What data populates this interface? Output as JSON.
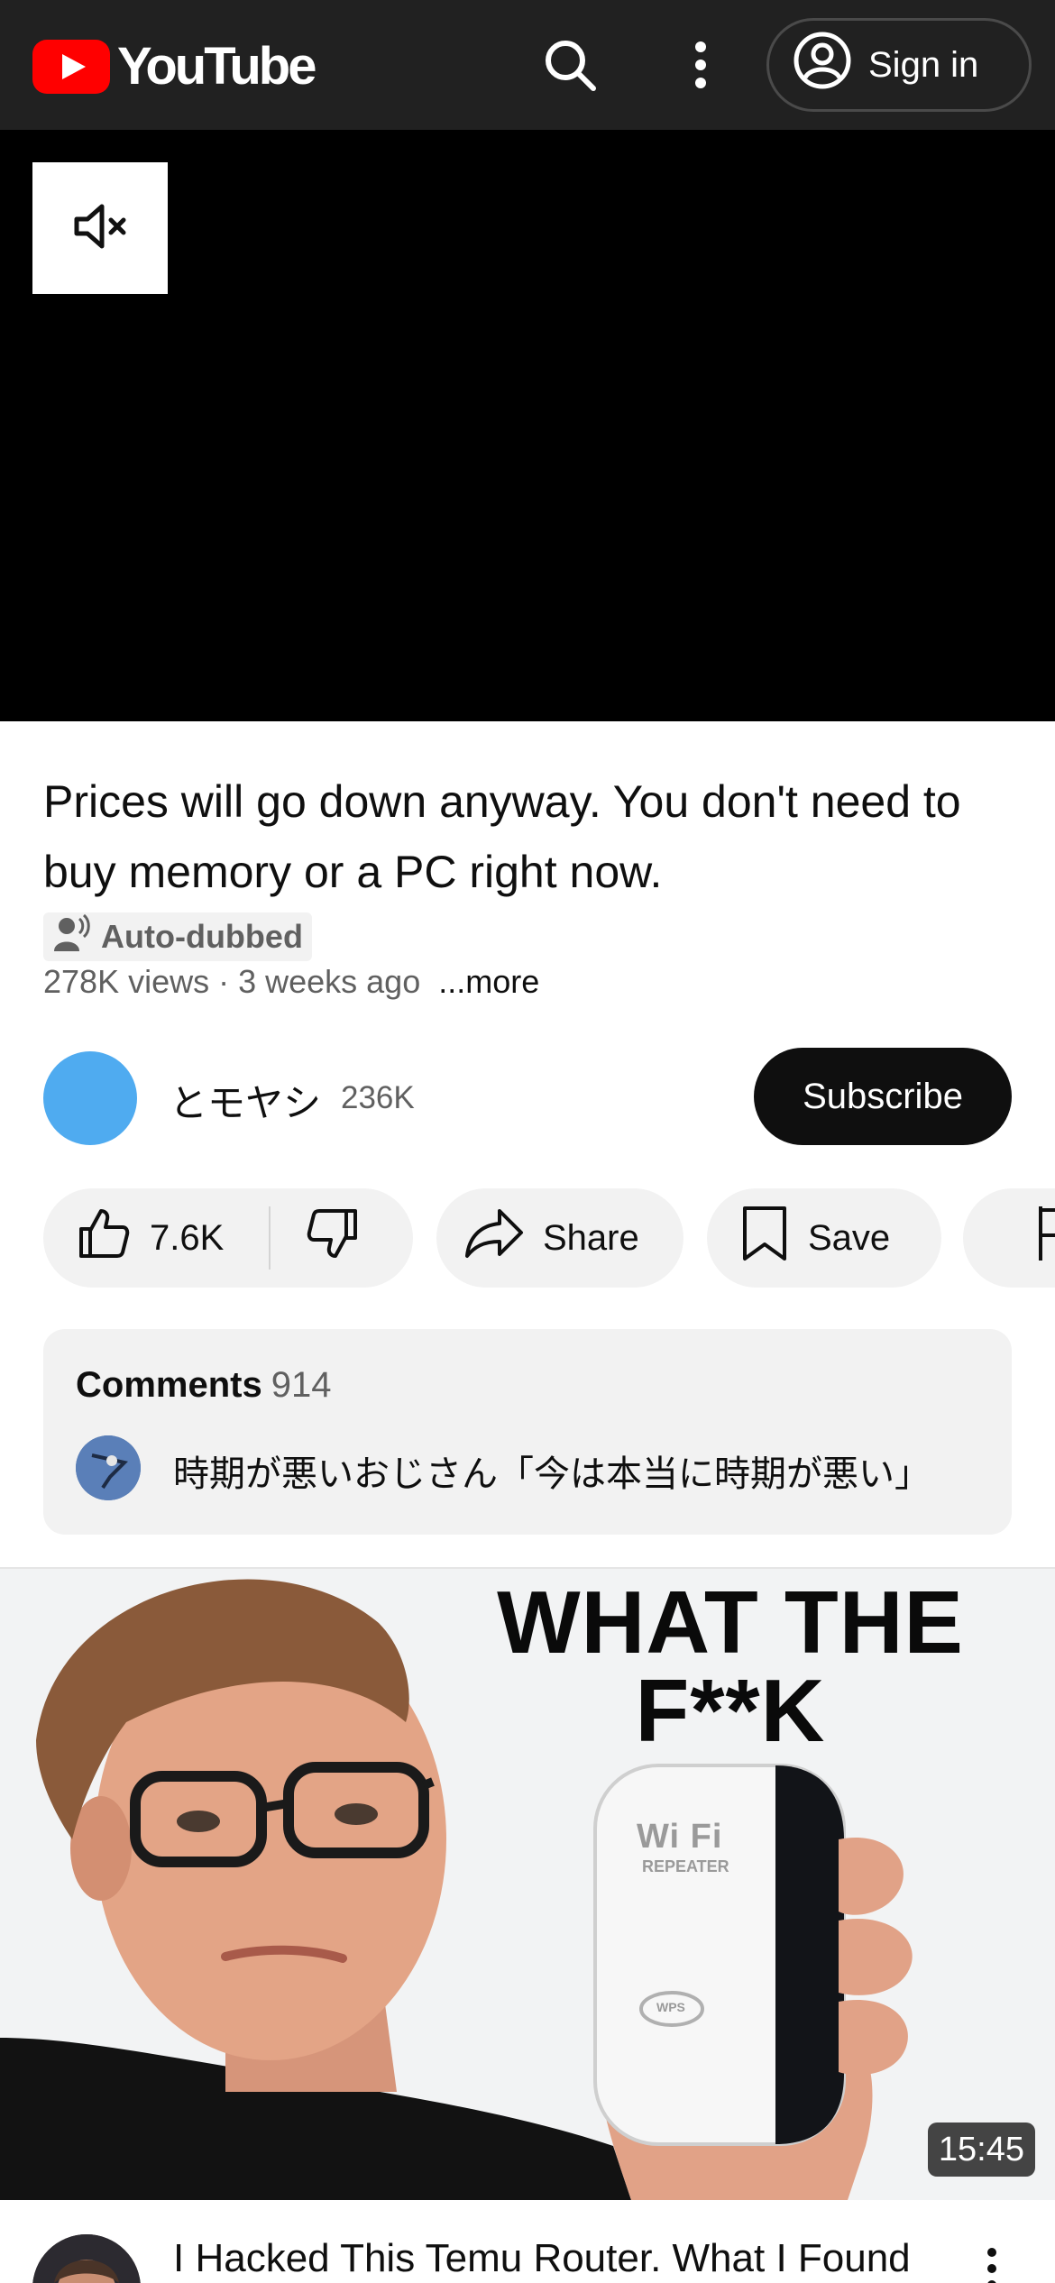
{
  "header": {
    "logo_text": "YouTube",
    "sign_in_label": "Sign in",
    "icons": [
      "search-icon",
      "more-vert-icon",
      "account-circle-icon"
    ]
  },
  "player": {
    "mute_icon": "volume-off-icon"
  },
  "video": {
    "title": "Prices will go down anyway. You don't need to buy memory or a PC right now.",
    "badge": "Auto-dubbed",
    "meta": "278K views · 3 weeks ago",
    "more_label": "...more"
  },
  "channel": {
    "name": "とモヤシ",
    "subscribers": "236K",
    "subscribe_label": "Subscribe"
  },
  "actions": {
    "like_count": "7.6K",
    "share_label": "Share",
    "save_label": "Save"
  },
  "comments": {
    "label": "Comments",
    "count": "914",
    "top_comment": "時期が悪いおじさん「今は本当に時期が悪い」"
  },
  "recommended": {
    "thumbnail_headline_1": "WHAT THE",
    "thumbnail_headline_2": "F**K",
    "duration": "15:45",
    "title": "I Hacked This Temu Router. What I Found",
    "device_brand": "Wi Fi",
    "device_sub": "REPEATER",
    "device_button": "WPS"
  },
  "colors": {
    "brand_red": "#ff0000",
    "header_bg": "#212121",
    "channel_avatar": "#4fabf0"
  }
}
